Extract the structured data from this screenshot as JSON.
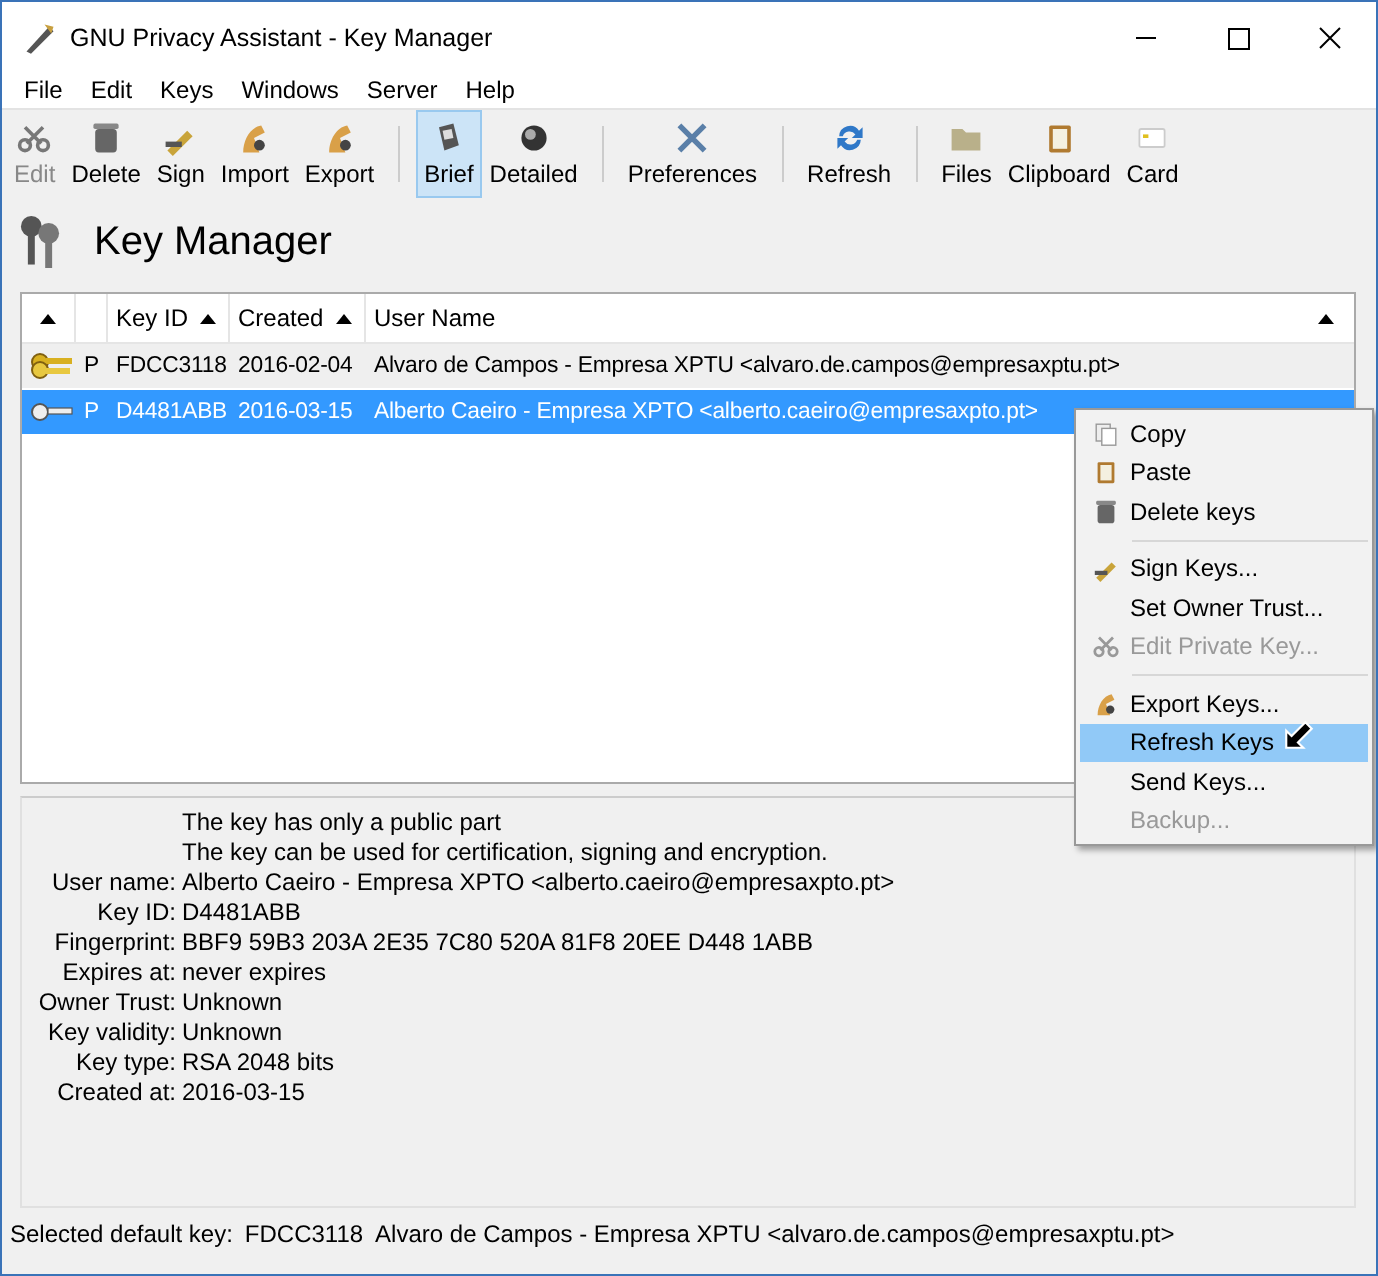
{
  "window": {
    "title": "GNU Privacy Assistant - Key Manager"
  },
  "menu": [
    {
      "label": "File"
    },
    {
      "label": "Edit"
    },
    {
      "label": "Keys"
    },
    {
      "label": "Windows"
    },
    {
      "label": "Server"
    },
    {
      "label": "Help"
    }
  ],
  "toolbar": [
    [
      {
        "label": "Edit",
        "disabled": true,
        "selected": false
      },
      {
        "label": "Delete",
        "disabled": false,
        "selected": false
      },
      {
        "label": "Sign",
        "disabled": false,
        "selected": false
      },
      {
        "label": "Import",
        "disabled": false,
        "selected": false
      },
      {
        "label": "Export",
        "disabled": false,
        "selected": false
      }
    ],
    [
      {
        "label": "Brief",
        "disabled": false,
        "selected": true
      },
      {
        "label": "Detailed",
        "disabled": false,
        "selected": false
      }
    ],
    [
      {
        "label": "Preferences",
        "disabled": false,
        "selected": false
      }
    ],
    [
      {
        "label": "Refresh",
        "disabled": false,
        "selected": false
      }
    ],
    [
      {
        "label": "Files",
        "disabled": false,
        "selected": false
      },
      {
        "label": "Clipboard",
        "disabled": false,
        "selected": false
      },
      {
        "label": "Card",
        "disabled": false,
        "selected": false
      }
    ]
  ],
  "heading": "Key Manager",
  "table": {
    "columns": [
      {
        "sorted": true
      },
      {
        "sorted": false
      },
      {
        "label": "Key ID",
        "sorted": true
      },
      {
        "label": "Created",
        "sorted": true
      },
      {
        "label": "User Name",
        "sorted": true
      }
    ],
    "rows": [
      {
        "kind": "pair",
        "type": "P",
        "key_id": "FDCC3118",
        "created": "2016-02-04",
        "user_name": "Alvaro de Campos - Empresa XPTU <alvaro.de.campos@empresaxptu.pt>",
        "selected": false
      },
      {
        "kind": "public",
        "type": "P",
        "key_id": "D4481ABB",
        "created": "2016-03-15",
        "user_name": "Alberto Caeiro - Empresa XPTO <alberto.caeiro@empresaxpto.pt>",
        "selected": true
      }
    ]
  },
  "details": [
    {
      "value": "The key has only a public part"
    },
    {
      "value": "The key can be used for certification, signing and encryption."
    },
    {
      "label": "User name:",
      "value": "Alberto Caeiro - Empresa XPTO <alberto.caeiro@empresaxpto.pt>"
    },
    {
      "label": "Key ID:",
      "value": "D4481ABB"
    },
    {
      "label": "Fingerprint:",
      "value": "BBF9 59B3 203A 2E35 7C80  520A 81F8 20EE D448 1ABB"
    },
    {
      "label": "Expires at:",
      "value": "never expires"
    },
    {
      "label": "Owner Trust:",
      "value": "Unknown"
    },
    {
      "label": "Key validity:",
      "value": "Unknown"
    },
    {
      "label": "Key type:",
      "value": "RSA 2048 bits"
    },
    {
      "label": "Created at:",
      "value": "2016-03-15"
    }
  ],
  "status_bar": {
    "label": "Selected default key:",
    "key_id": "FDCC3118",
    "user_name": "Alvaro de Campos - Empresa XPTU <alvaro.de.campos@empresaxptu.pt>"
  },
  "context_menu": [
    {
      "kind": "item",
      "label": "Copy",
      "disabled": false,
      "selected": false
    },
    {
      "kind": "item",
      "label": "Paste",
      "disabled": false,
      "selected": false
    },
    {
      "kind": "item",
      "label": "Delete keys",
      "disabled": false,
      "selected": false
    },
    {
      "kind": "separator"
    },
    {
      "kind": "item",
      "label": "Sign Keys...",
      "disabled": false,
      "selected": false
    },
    {
      "kind": "item",
      "label": "Set Owner Trust...",
      "disabled": false,
      "selected": false
    },
    {
      "kind": "item",
      "label": "Edit Private Key...",
      "disabled": true,
      "selected": false
    },
    {
      "kind": "separator"
    },
    {
      "kind": "item",
      "label": "Export Keys...",
      "disabled": false,
      "selected": false
    },
    {
      "kind": "item",
      "label": "Refresh Keys",
      "disabled": false,
      "selected": true
    },
    {
      "kind": "item",
      "label": "Send Keys...",
      "disabled": false,
      "selected": false
    },
    {
      "kind": "item",
      "label": "Backup...",
      "disabled": true,
      "selected": false
    }
  ]
}
